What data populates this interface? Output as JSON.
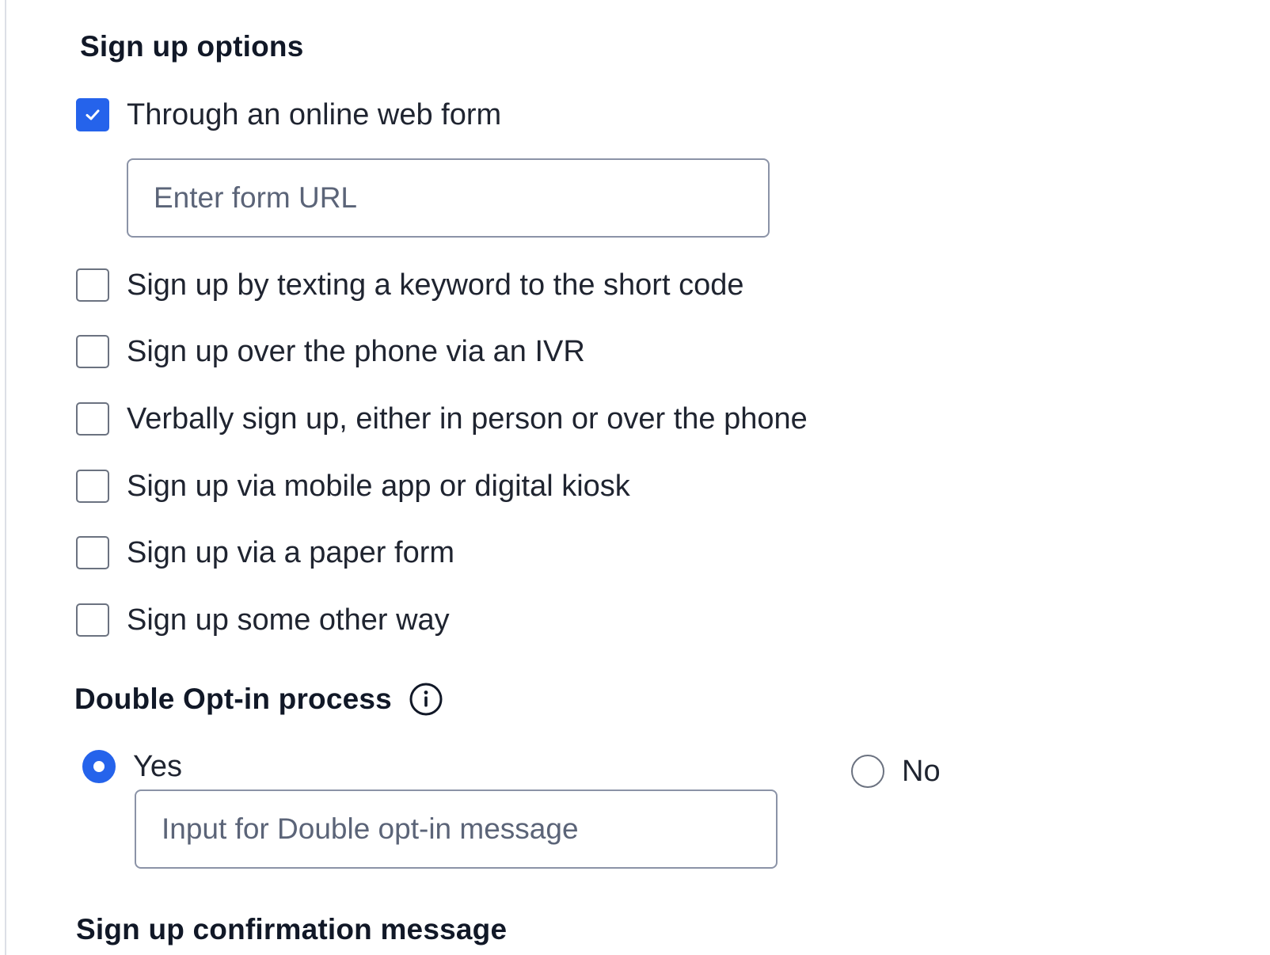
{
  "signup_options": {
    "title": "Sign up options",
    "items": [
      {
        "label": "Through an online web form",
        "checked": true
      },
      {
        "label": "Sign up by texting a keyword to the short code",
        "checked": false
      },
      {
        "label": "Sign up over the phone via an IVR",
        "checked": false
      },
      {
        "label": "Verbally sign up, either in person or over the phone",
        "checked": false
      },
      {
        "label": "Sign up via mobile app or digital kiosk",
        "checked": false
      },
      {
        "label": "Sign up via a paper form",
        "checked": false
      },
      {
        "label": "Sign up some other way",
        "checked": false
      }
    ],
    "form_url_input": {
      "placeholder": "Enter form URL",
      "value": ""
    }
  },
  "double_opt_in": {
    "title": "Double Opt-in process",
    "info_icon": "info-circle-icon",
    "options": [
      {
        "label": "Yes",
        "selected": true
      },
      {
        "label": "No",
        "selected": false
      }
    ],
    "message_input": {
      "placeholder": "Input for Double opt-in message",
      "value": ""
    }
  },
  "confirmation": {
    "title": "Sign up confirmation message"
  },
  "colors": {
    "accent": "#2563eb",
    "text": "#1f2430",
    "border": "#8b93a7"
  }
}
